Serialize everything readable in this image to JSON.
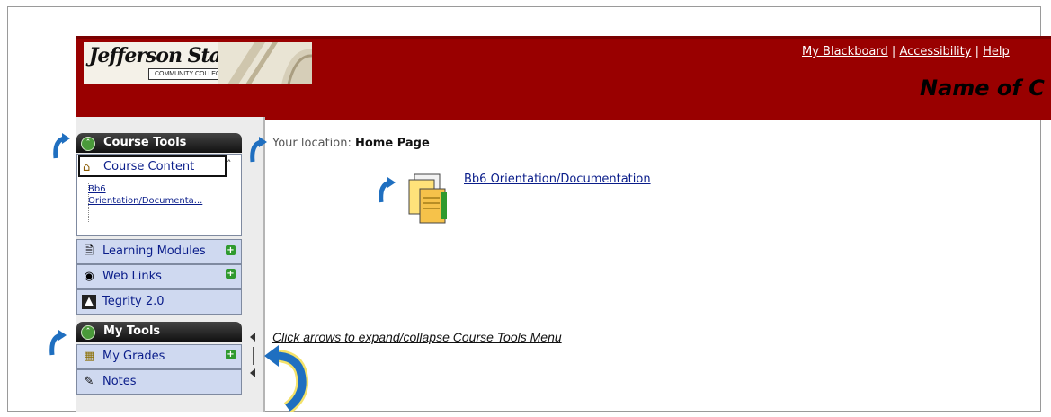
{
  "header": {
    "logo_text": "Jefferson State",
    "logo_subtext": "COMMUNITY COLLEGE",
    "links": [
      "My Blackboard",
      "Accessibility",
      "Help"
    ],
    "separator": "|",
    "course_name": "Name of C"
  },
  "course_tools": {
    "title": "Course Tools",
    "selected": "Course Content",
    "tree_link": "Bb6 Orientation/Documenta...",
    "items": [
      {
        "label": "Learning Modules",
        "icon": "learning-modules-icon"
      },
      {
        "label": "Web Links",
        "icon": "web-links-icon"
      },
      {
        "label": "Tegrity 2.0",
        "icon": "tegrity-icon"
      }
    ]
  },
  "my_tools": {
    "title": "My Tools",
    "items": [
      {
        "label": "My Grades",
        "icon": "grades-icon"
      },
      {
        "label": "Notes",
        "icon": "notes-icon"
      }
    ]
  },
  "main": {
    "location_label": "Your location:",
    "location_value": "Home Page",
    "item_link": "Bb6 Orientation/Documentation",
    "annotation": "Click arrows to expand/collapse Course Tools Menu"
  },
  "colors": {
    "header_bg": "#990000",
    "link": "#0a1d8a",
    "menu_row_bg": "#cfd9f0",
    "annotation_arrow": "#1f6fc0"
  }
}
